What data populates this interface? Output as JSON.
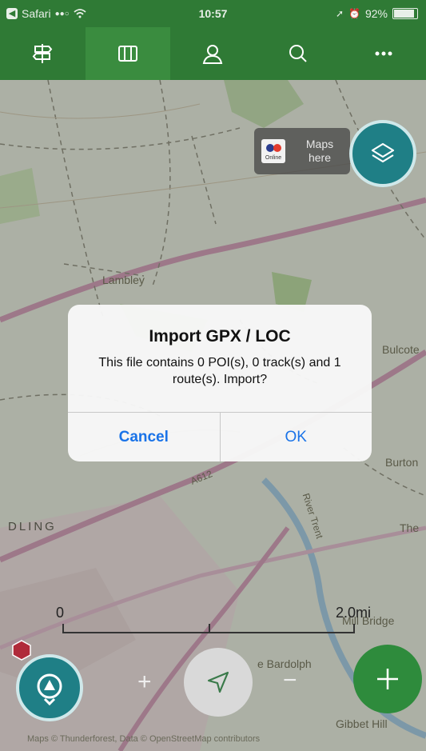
{
  "status_bar": {
    "back_app": "Safari",
    "time": "10:57",
    "battery": "92%"
  },
  "nav_tabs": [
    {
      "icon": "signpost-icon"
    },
    {
      "icon": "map-book-icon",
      "active": true
    },
    {
      "icon": "user-icon"
    },
    {
      "icon": "search-icon"
    },
    {
      "icon": "more-icon"
    }
  ],
  "map": {
    "labels": {
      "lambley": "Lambley",
      "bulcote": "Bulcote",
      "burton": "Burton",
      "the": "The",
      "river_trent": "River Trent",
      "a612": "A612",
      "gedling": "DLING",
      "mill_bridge": "Mill Bridge",
      "bardolph": "e Bardolph",
      "gibbet_hill": "Gibbet Hill"
    },
    "os_banner": {
      "logo_sub": "Online",
      "text_line1": "Maps",
      "text_line2": "here"
    },
    "scale": {
      "start": "0",
      "end": "2.0mi"
    },
    "zoom_in": "+",
    "zoom_out": "−",
    "attribution": "Maps © Thunderforest, Data © OpenStreetMap contributors"
  },
  "alert": {
    "title": "Import GPX / LOC",
    "message": "This file contains 0 POI(s), 0 track(s) and 1 route(s). Import?",
    "cancel_label": "Cancel",
    "ok_label": "OK"
  },
  "colors": {
    "nav_green": "#2f7a35",
    "teal": "#1f7f86",
    "add_green": "#2e8b3c",
    "link_blue": "#1a73e8"
  }
}
